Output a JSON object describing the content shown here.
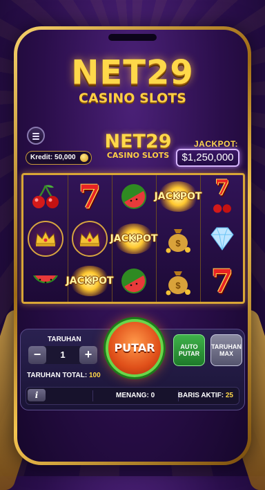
{
  "logo": {
    "title": "NET29",
    "subtitle": "CASINO SLOTS"
  },
  "header": {
    "credit_label": "Kredit:",
    "credit_value": "50,000",
    "jackpot_label": "JACKPOT:",
    "jackpot_value": "$1,250,000"
  },
  "reels": [
    [
      "cherry",
      "crown",
      "watermelon"
    ],
    [
      "seven",
      "crown",
      "jackpot"
    ],
    [
      "watermelon",
      "jackpot",
      "watermelon"
    ],
    [
      "jackpot",
      "money-bag",
      "money-bag"
    ],
    [
      "seven-cherry",
      "diamond",
      "seven"
    ]
  ],
  "symbols": {
    "jackpot_text": "JACKPOT"
  },
  "controls": {
    "bet_label": "TARUHAN",
    "bet_value": "1",
    "minus": "−",
    "plus": "+",
    "total_label": "TARUHAN TOTAL:",
    "total_value": "100",
    "spin_label": "PUTAR",
    "auto_label_1": "AUTO",
    "auto_label_2": "PUTAR",
    "max_label_1": "TARUHAN",
    "max_label_2": "MAX"
  },
  "status": {
    "info": "i",
    "win_label": "MENANG:",
    "win_value": "0",
    "lines_label": "BARIS AKTIF:",
    "lines_value": "25"
  },
  "colors": {
    "gold": "#ffd84a",
    "spin": "#e0501a",
    "auto": "#3fb14a",
    "jackpot_border": "#d7b6ff"
  }
}
